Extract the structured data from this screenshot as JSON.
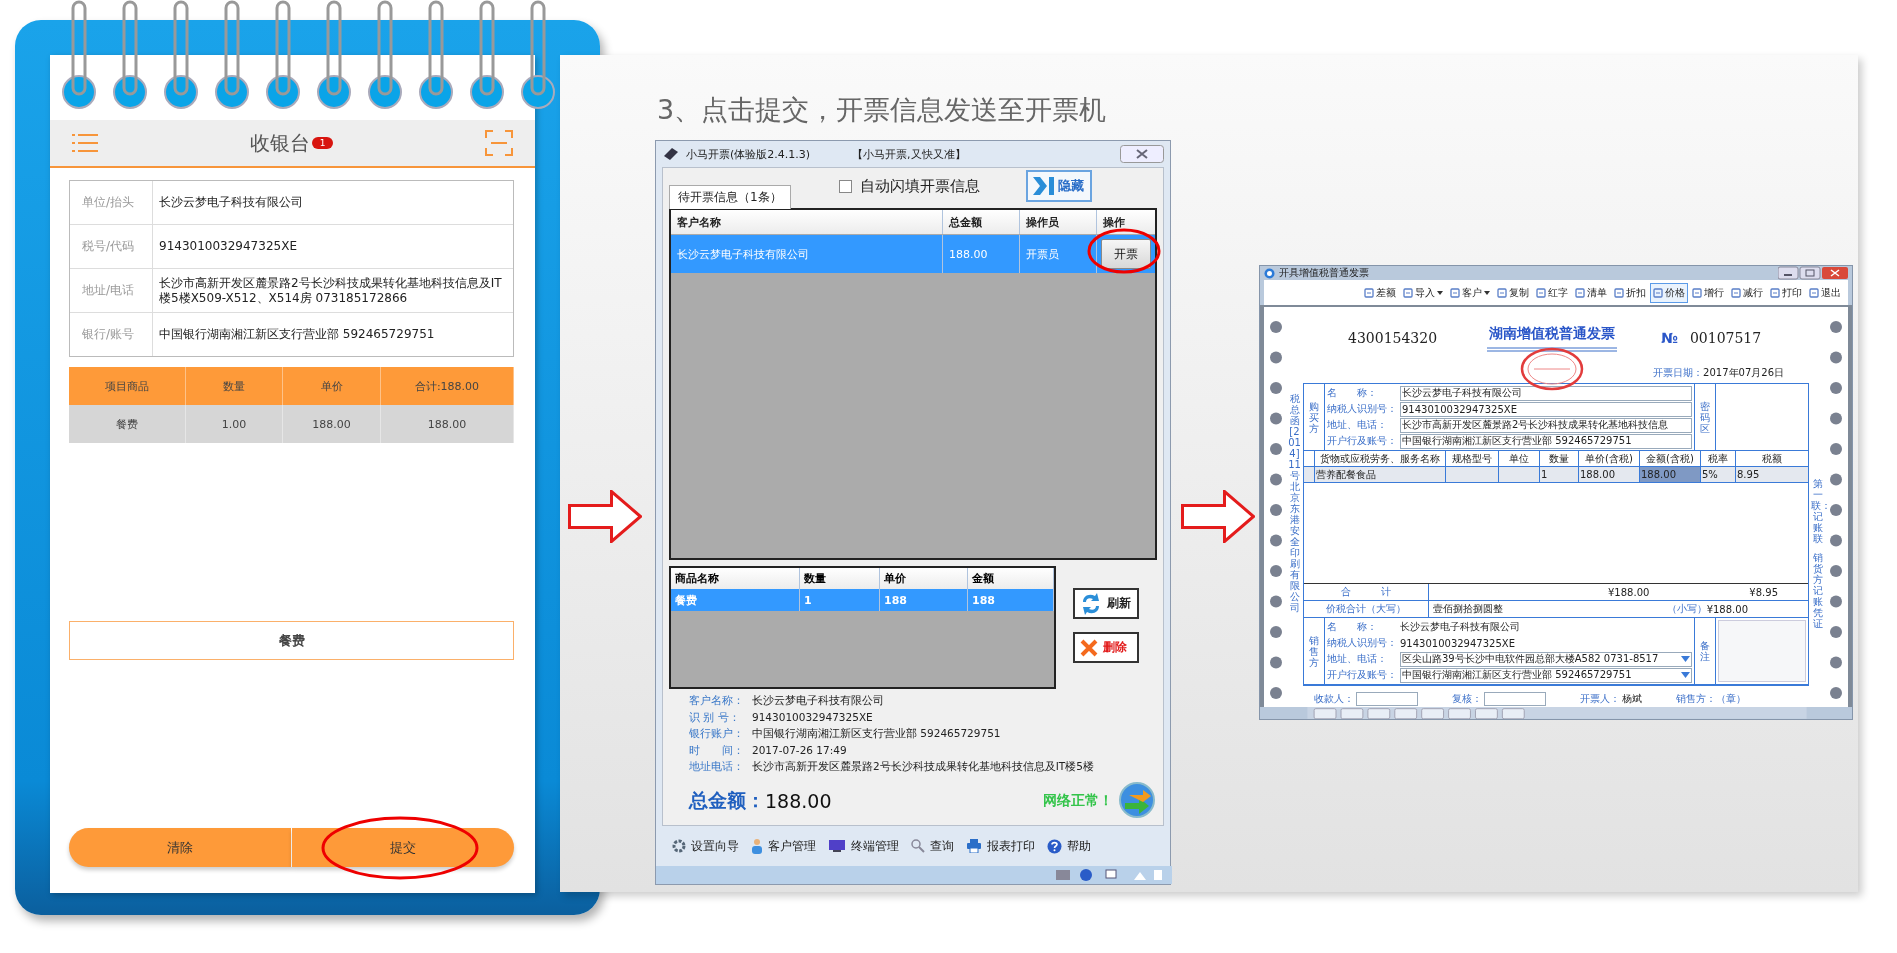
{
  "phone": {
    "title": "收银台",
    "badge": "1",
    "info_rows": [
      {
        "label": "单位/抬头",
        "value": "长沙云梦电子科技有限公司"
      },
      {
        "label": "税号/代码",
        "value": "9143010032947325XE"
      },
      {
        "label": "地址/电话",
        "value": "长沙市高新开发区麓景路2号长沙科技成果转化基地科技信息及IT楼5楼X509-X512、X514房 073185172866"
      },
      {
        "label": "银行/账号",
        "value": "中国银行湖南湘江新区支行营业部 592465729751"
      }
    ],
    "items_columns": [
      "项目商品",
      "数量",
      "单价",
      "合计:188.00"
    ],
    "items_rows": [
      [
        "餐费",
        "1.00",
        "188.00",
        "188.00"
      ]
    ],
    "product_button": "餐费",
    "buttons": [
      {
        "label": "清除",
        "highlighted": false
      },
      {
        "label": "提交",
        "highlighted": true
      }
    ]
  },
  "step_title": "3、点击提交，开票信息发送至开票机",
  "invoicing_app": {
    "title": "小马开票(体验版2.4.1.3)",
    "slogan": "【小马开票,又快又准】",
    "tab": {
      "label": "待开票信息（1条）",
      "selected": true
    },
    "auto_fill": {
      "label": "自动闪填开票信息",
      "checked": false
    },
    "hide_button": "隐藏",
    "pending_columns": [
      "客户名称",
      "总金额",
      "操作员",
      "操作"
    ],
    "pending_rows": [
      {
        "cells": [
          "长沙云梦电子科技有限公司",
          "188.00",
          "开票员"
        ],
        "action": "开票",
        "selected": true,
        "highlighted": true
      }
    ],
    "goods_columns": [
      "商品名称",
      "数量",
      "单价",
      "金额"
    ],
    "goods_rows": [
      {
        "cells": [
          "餐费",
          "1",
          "188",
          "188"
        ],
        "selected": true
      }
    ],
    "refresh_button": "刷新",
    "delete_button": "删除",
    "details": [
      {
        "label": "客户名称：",
        "value": "长沙云梦电子科技有限公司"
      },
      {
        "label": "识 别 号：",
        "value": "9143010032947325XE"
      },
      {
        "label": "银行账户：",
        "value": "中国银行湖南湘江新区支行营业部 592465729751"
      },
      {
        "label": "时　　间：",
        "value": "2017-07-26 17:49"
      },
      {
        "label": "地址电话：",
        "value": "长沙市高新开发区麓景路2号长沙科技成果转化基地科技信息及IT楼5楼"
      }
    ],
    "total_label": "总金额：",
    "total_value": "188.00",
    "network_status": "网络正常！",
    "toolbar": [
      "设置向导",
      "客户管理",
      "终端管理",
      "查询",
      "报表打印",
      "帮助"
    ]
  },
  "invoice_window": {
    "title": "开具增值税普通发票",
    "toolbar": [
      {
        "label": "差额",
        "dropdown": false,
        "selected": false
      },
      {
        "label": "导入",
        "dropdown": true,
        "selected": false
      },
      {
        "label": "客户",
        "dropdown": true,
        "selected": false
      },
      {
        "label": "复制",
        "dropdown": false,
        "selected": false
      },
      {
        "label": "红字",
        "dropdown": false,
        "selected": false
      },
      {
        "label": "清单",
        "dropdown": false,
        "selected": false
      },
      {
        "label": "折扣",
        "dropdown": false,
        "selected": false
      },
      {
        "label": "价格",
        "dropdown": false,
        "selected": true
      },
      {
        "label": "增行",
        "dropdown": false,
        "selected": false
      },
      {
        "label": "减行",
        "dropdown": false,
        "selected": false
      },
      {
        "label": "打印",
        "dropdown": false,
        "selected": false
      },
      {
        "label": "退出",
        "dropdown": false,
        "selected": false
      }
    ],
    "invoice_code": "4300154320",
    "invoice_title": "湖南增值税普通发票",
    "number_sign": "№",
    "invoice_number": "00107517",
    "date_label": "开票日期：",
    "date": "2017年07月26日",
    "left_margin_text": "税总函[2014]11号北京东港安全印刷有限公司",
    "right_margin_texts": [
      "第一联：记账联",
      "销货方记账凭证"
    ],
    "buyer": {
      "side_label": "购买方",
      "cipher_label": "密码区",
      "fields": [
        {
          "label": "名　　称：",
          "value": "长沙云梦电子科技有限公司"
        },
        {
          "label": "纳税人识别号：",
          "value": "9143010032947325XE"
        },
        {
          "label": "地址、电话：",
          "value": "长沙市高新开发区麓景路2号长沙科技成果转化基地科技信息"
        },
        {
          "label": "开户行及账号：",
          "value": "中国银行湖南湘江新区支行营业部 592465729751"
        }
      ]
    },
    "item_columns": [
      "货物或应税劳务、服务名称",
      "规格型号",
      "单位",
      "数量",
      "单价(含税)",
      "金额(含税)",
      "税率",
      "税额"
    ],
    "item_rows": [
      {
        "cells": [
          {
            "text": "营养配餐食品",
            "selected": false
          },
          {
            "selected": false
          },
          {
            "selected": false
          },
          {
            "text": "1",
            "selected": false
          },
          {
            "text": "188.00",
            "selected": false
          },
          {
            "text": "188.00",
            "selected": true
          },
          {
            "text": "5%",
            "selected": false
          },
          {
            "text": "8.95",
            "selected": false
          }
        ]
      }
    ],
    "total_label": "合　　　计",
    "total_amount": "¥188.00",
    "total_tax": "¥8.95",
    "grand_total_label": "价税合计（大写）",
    "grand_total_words": "壹佰捌拾捌圆整",
    "grand_total_small_label": "（小写）",
    "grand_total": "¥188.00",
    "seller": {
      "side_label": "销售方",
      "remarks_label": "备注",
      "fields": [
        {
          "label": "名　　称：",
          "value": "长沙云梦电子科技有限公司",
          "kind": "text"
        },
        {
          "label": "纳税人识别号：",
          "value": "9143010032947325XE",
          "kind": "text"
        },
        {
          "label": "地址、电话：",
          "value": "区尖山路39号长沙中电软件园总部大楼A582 0731-8517",
          "kind": "dropdown"
        },
        {
          "label": "开户行及账号：",
          "value": "中国银行湖南湘江新区支行营业部 592465729751",
          "kind": "dropdown"
        }
      ]
    },
    "signatures": [
      {
        "label": "收款人：",
        "kind": "field"
      },
      {
        "label": "复核：",
        "kind": "field"
      },
      {
        "label": "开票人：",
        "value": "杨斌",
        "kind": "text"
      },
      {
        "label": "销售方：（章）",
        "kind": "text"
      }
    ]
  }
}
